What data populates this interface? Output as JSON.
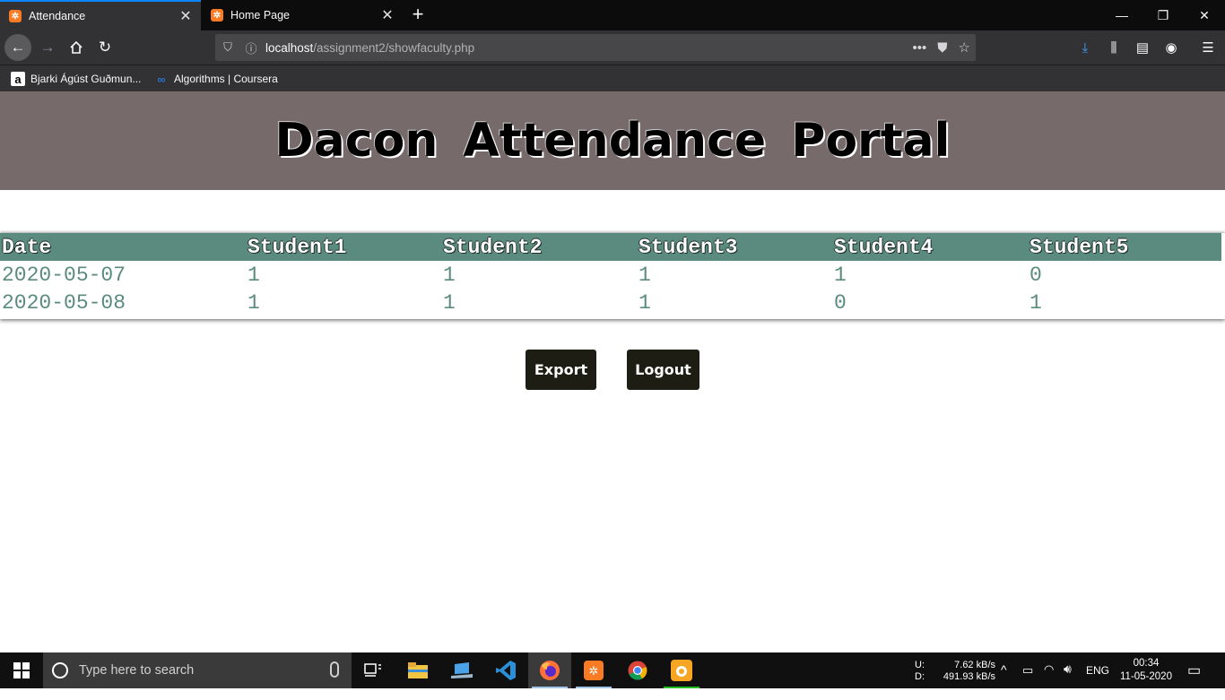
{
  "browser": {
    "tabs": [
      {
        "title": "Attendance",
        "active": true
      },
      {
        "title": "Home Page",
        "active": false
      }
    ],
    "url": {
      "host": "localhost",
      "path": "/assignment2/showfaculty.php"
    },
    "bookmarks": [
      {
        "label": "Bjarki Ágúst Guðmun...",
        "icon": "a"
      },
      {
        "label": "Algorithms | Coursera",
        "icon": "co"
      }
    ]
  },
  "page": {
    "title": "Dacon Attendance Portal",
    "table": {
      "headers": [
        "Date",
        "Student1",
        "Student2",
        "Student3",
        "Student4",
        "Student5"
      ],
      "rows": [
        [
          "2020-05-07",
          "1",
          "1",
          "1",
          "1",
          "0"
        ],
        [
          "2020-05-08",
          "1",
          "1",
          "1",
          "0",
          "1"
        ]
      ]
    },
    "buttons": {
      "export": "Export",
      "logout": "Logout"
    }
  },
  "taskbar": {
    "search_placeholder": "Type here to search",
    "net_labels": {
      "up": "U:",
      "down": "D:"
    },
    "net_up": "7.62 kB/s",
    "net_down": "491.93 kB/s",
    "language": "ENG",
    "time": "00:34",
    "date": "11-05-2020"
  },
  "colors": {
    "header_bg": "#766a6b",
    "table_header_bg": "#5b8b7e",
    "table_text": "#5b8b7e",
    "button_bg": "#1e1d14",
    "tab_accent": "#0a84ff"
  }
}
